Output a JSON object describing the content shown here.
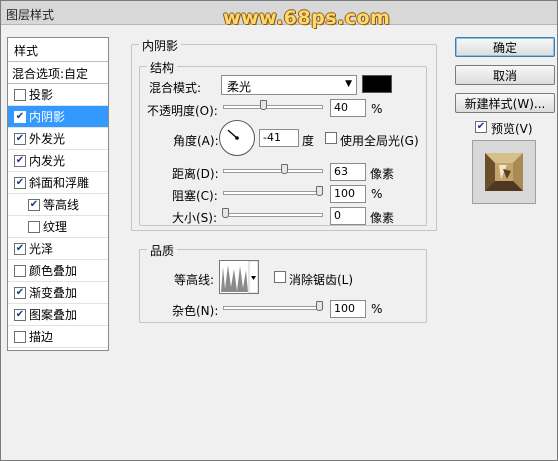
{
  "window": {
    "title": "图层样式",
    "watermark": "www.68ps.com"
  },
  "style_list": {
    "header": "样式",
    "blend_options": "混合选项:自定",
    "items": [
      {
        "label": "投影",
        "checked": false,
        "selected": false,
        "indent": false
      },
      {
        "label": "内阴影",
        "checked": true,
        "selected": true,
        "indent": false
      },
      {
        "label": "外发光",
        "checked": true,
        "selected": false,
        "indent": false
      },
      {
        "label": "内发光",
        "checked": true,
        "selected": false,
        "indent": false
      },
      {
        "label": "斜面和浮雕",
        "checked": true,
        "selected": false,
        "indent": false
      },
      {
        "label": "等高线",
        "checked": true,
        "selected": false,
        "indent": true
      },
      {
        "label": "纹理",
        "checked": false,
        "selected": false,
        "indent": true
      },
      {
        "label": "光泽",
        "checked": true,
        "selected": false,
        "indent": false
      },
      {
        "label": "颜色叠加",
        "checked": false,
        "selected": false,
        "indent": false
      },
      {
        "label": "渐变叠加",
        "checked": true,
        "selected": false,
        "indent": false
      },
      {
        "label": "图案叠加",
        "checked": true,
        "selected": false,
        "indent": false
      },
      {
        "label": "描边",
        "checked": false,
        "selected": false,
        "indent": false
      }
    ]
  },
  "inner_shadow": {
    "section_title": "内阴影",
    "structure": {
      "title": "结构",
      "blend_mode_label": "混合模式:",
      "blend_mode_value": "柔光",
      "color": "#000000",
      "opacity_label": "不透明度(O):",
      "opacity_value": "40",
      "opacity_fraction": 0.4,
      "percent": "%",
      "angle_label": "角度(A):",
      "angle_value": "-41",
      "angle_unit": "度",
      "global_light_label": "使用全局光(G)",
      "global_light_checked": false,
      "distance_label": "距离(D):",
      "distance_value": "63",
      "distance_fraction": 0.63,
      "pixels": "像素",
      "choke_label": "阻塞(C):",
      "choke_value": "100",
      "choke_fraction": 1.0,
      "size_label": "大小(S):",
      "size_value": "0",
      "size_fraction": 0.0
    },
    "quality": {
      "title": "品质",
      "contour_label": "等高线:",
      "anti_alias_label": "消除锯齿(L)",
      "anti_alias_checked": false,
      "noise_label": "杂色(N):",
      "noise_value": "100",
      "noise_fraction": 1.0
    }
  },
  "buttons": {
    "ok": "确定",
    "cancel": "取消",
    "new_style": "新建样式(W)...",
    "preview_label": "预览(V)",
    "preview_checked": true
  }
}
